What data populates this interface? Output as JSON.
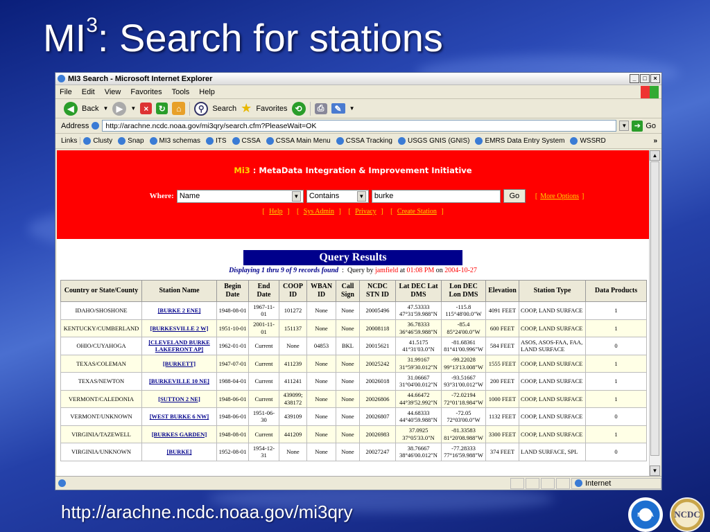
{
  "slide": {
    "title_main": "MI",
    "title_sup": "3",
    "title_rest": ": Search for stations",
    "footer_url": "http://arachne.ncdc.noaa.gov/mi3qry",
    "logo_left": "NOAA",
    "logo_right": "NCDC"
  },
  "window": {
    "title": "MI3 Search - Microsoft Internet Explorer",
    "controls": [
      "_",
      "□",
      "×"
    ],
    "menu": [
      "File",
      "Edit",
      "View",
      "Favorites",
      "Tools",
      "Help"
    ],
    "toolbar": {
      "back": "Back",
      "search": "Search",
      "favorites": "Favorites"
    },
    "address_label": "Address",
    "address": "http://arachne.ncdc.noaa.gov/mi3qry/search.cfm?PleaseWait=OK",
    "go_label": "Go",
    "links_label": "Links",
    "links": [
      "Clusty",
      "Snap",
      "MI3 schemas",
      "ITS",
      "CSSA",
      "CSSA Main Menu",
      "CSSA Tracking",
      "USGS GNIS (GNIS)",
      "EMRS Data Entry System",
      "WSSRD"
    ],
    "status_zone": "Internet"
  },
  "page": {
    "banner_prefix": "Mi3",
    "banner_title": " : MetaData Integration & Improvement Initiative",
    "where_label": "Where:",
    "field_select": "Name",
    "op_select": "Contains",
    "search_value": "burke",
    "go_button": "Go",
    "more_options": "More Options",
    "nav": [
      "Help",
      "Sys Admin",
      "Privacy",
      "Create Station"
    ],
    "results_title": "Query Results",
    "displaying": "Displaying 1 thru 9 of 9 records found",
    "query_by_label": "Query by",
    "query_user": "jamfield",
    "at_label": "at",
    "query_time": "01:08 PM",
    "on_label": "on",
    "query_date": "2004-10-27"
  },
  "table": {
    "headers": [
      "Country or State/County",
      "Station Name",
      "Begin Date",
      "End Date",
      "COOP ID",
      "WBAN ID",
      "Call Sign",
      "NCDC STN ID",
      "Lat DEC Lat DMS",
      "Lon DEC Lon DMS",
      "Elevation",
      "Station Type",
      "Data Products"
    ],
    "rows": [
      [
        "IDAHO/SHOSHONE",
        "[BURKE 2 ENE]",
        "1948-08-01",
        "1967-11-01",
        "101272",
        "None",
        "None",
        "20005496",
        "47.53333 47°31'59.988\"N",
        "-115.8 115°48'00.0\"W",
        "4091 FEET",
        "COOP, LAND SURFACE",
        "1"
      ],
      [
        "KENTUCKY/CUMBERLAND",
        "[BURKESVILLE 2 W]",
        "1951-10-01",
        "2001-11-01",
        "151137",
        "None",
        "None",
        "20008118",
        "36.78333 36°46'59.988\"N",
        "-85.4 85°24'00.0\"W",
        "600 FEET",
        "COOP, LAND SURFACE",
        "1"
      ],
      [
        "OHIO/CUYAHOGA",
        "[CLEVELAND BURKE LAKEFRONT AP]",
        "1962-01-01",
        "Current",
        "None",
        "04853",
        "BKL",
        "20015621",
        "41.5175 41°31'03.0\"N",
        "-81.68361 81°41'00.996\"W",
        "584 FEET",
        "ASOS, ASOS-FAA, FAA, LAND SURFACE",
        "0"
      ],
      [
        "TEXAS/COLEMAN",
        "[BURKETT]",
        "1947-07-01",
        "Current",
        "411239",
        "None",
        "None",
        "20025242",
        "31.99167 31°59'30.012\"N",
        "-99.22028 99°13'13.008\"W",
        "1555 FEET",
        "COOP, LAND SURFACE",
        "1"
      ],
      [
        "TEXAS/NEWTON",
        "[BURKEVILLE 10 NE]",
        "1988-04-01",
        "Current",
        "411241",
        "None",
        "None",
        "20026018",
        "31.06667 31°04'00.012\"N",
        "-93.51667 93°31'00.012\"W",
        "200 FEET",
        "COOP, LAND SURFACE",
        "1"
      ],
      [
        "VERMONT/CALEDONIA",
        "[SUTTON 2 NE]",
        "1948-06-01",
        "Current",
        "439099; 438172",
        "None",
        "None",
        "20026806",
        "44.66472 44°39'52.992\"N",
        "-72.02194 72°01'18.984\"W",
        "1000 FEET",
        "COOP, LAND SURFACE",
        "1"
      ],
      [
        "VERMONT/UNKNOWN",
        "[WEST BURKE 6 NW]",
        "1948-06-01",
        "1951-06-30",
        "439109",
        "None",
        "None",
        "20026807",
        "44.68333 44°40'59.988\"N",
        "-72.05 72°03'00.0\"W",
        "1132 FEET",
        "COOP, LAND SURFACE",
        "0"
      ],
      [
        "VIRGINIA/TAZEWELL",
        "[BURKES GARDEN]",
        "1948-08-01",
        "Current",
        "441209",
        "None",
        "None",
        "20026983",
        "37.0925 37°05'33.0\"N",
        "-81.33583 81°20'08.988\"W",
        "3300 FEET",
        "COOP, LAND SURFACE",
        "1"
      ],
      [
        "VIRGINIA/UNKNOWN",
        "[BURKE]",
        "1952-08-01",
        "1954-12-31",
        "None",
        "None",
        "None",
        "20027247",
        "38.76667 38°46'00.012\"N",
        "-77.28333 77°16'59.988\"W",
        "374 FEET",
        "LAND SURFACE, SPL",
        "0"
      ]
    ]
  }
}
